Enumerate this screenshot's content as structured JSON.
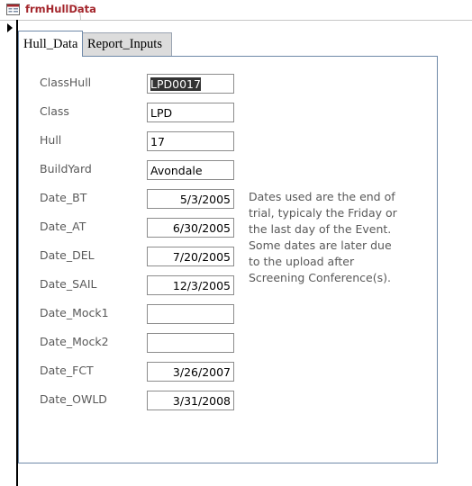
{
  "window": {
    "doc_tab_title": "frmHullData",
    "icon": "form-icon"
  },
  "tabs": [
    {
      "label": "Hull_Data",
      "active": true
    },
    {
      "label": "Report_Inputs",
      "active": false
    }
  ],
  "fields": [
    {
      "label": "ClassHull",
      "value": "LPD0017",
      "align": "left",
      "selected": true
    },
    {
      "label": "Class",
      "value": "LPD",
      "align": "left"
    },
    {
      "label": "Hull",
      "value": "17",
      "align": "left"
    },
    {
      "label": "BuildYard",
      "value": "Avondale",
      "align": "left"
    },
    {
      "label": "Date_BT",
      "value": "5/3/2005",
      "align": "right"
    },
    {
      "label": "Date_AT",
      "value": "6/30/2005",
      "align": "right"
    },
    {
      "label": "Date_DEL",
      "value": "7/20/2005",
      "align": "right"
    },
    {
      "label": "Date_SAIL",
      "value": "12/3/2005",
      "align": "right"
    },
    {
      "label": "Date_Mock1",
      "value": "",
      "align": "right"
    },
    {
      "label": "Date_Mock2",
      "value": "",
      "align": "right"
    },
    {
      "label": "Date_FCT",
      "value": "3/26/2007",
      "align": "right"
    },
    {
      "label": "Date_OWLD",
      "value": "3/31/2008",
      "align": "right"
    }
  ],
  "note": "Dates used are the end of trial, typicaly the Friday or the last day of the Event. Some dates are later due to the upload after Screening Conference(s).",
  "colors": {
    "doc_tab_text": "#a4262c",
    "label_text": "#595959",
    "tab_border": "#6f89a8",
    "inactive_tab_bg": "#dcdcdc"
  }
}
